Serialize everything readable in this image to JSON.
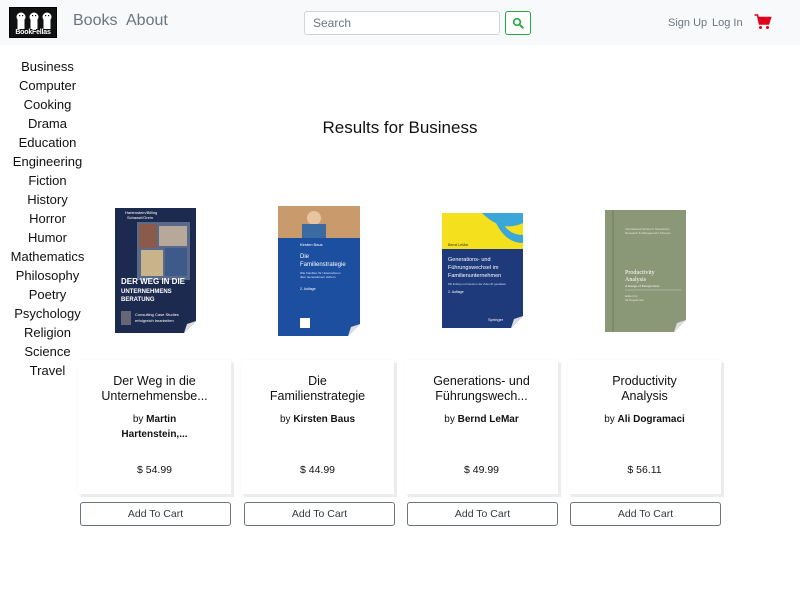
{
  "header": {
    "logo_text": "BookFellas",
    "nav_books": "Books",
    "nav_about": "About",
    "search_placeholder": "Search",
    "sign_up": "Sign Up",
    "log_in": "Log In",
    "cart_color": "#e3001b",
    "search_button_color": "#28a745"
  },
  "sidebar": {
    "categories": [
      "Business",
      "Computer",
      "Cooking",
      "Drama",
      "Education",
      "Engineering",
      "Fiction",
      "History",
      "Horror",
      "Humor",
      "Mathematics",
      "Philosophy",
      "Poetry",
      "Psychology",
      "Religion",
      "Science",
      "Travel"
    ]
  },
  "main": {
    "results_title": "Results for Business",
    "add_to_cart_label": "Add To Cart",
    "books": [
      {
        "title_line1": "Der Weg in die",
        "title_line2": "Unternehmensbe...",
        "by": "by",
        "author_line1": "Martin",
        "author_line2": "Hartenstein,...",
        "price": "$ 54.99",
        "cover_text_top": "Hartenstein/Billing Schawel/Grein",
        "cover_title": "DER WEG IN DIE UNTERNEHMENS BERATUNG",
        "cover_sub": "Consulting Case Studies erfolgreich bearbeiten",
        "cover_color": "#1d2a4f"
      },
      {
        "title_line1": "Die",
        "title_line2": "Familienstrategie",
        "by": "by",
        "author_line1": "Kirsten Baus",
        "author_line2": "",
        "price": "$ 44.99",
        "cover_text_top": "Kirsten Baus",
        "cover_title": "Die Familienstrategie",
        "cover_sub": "Wie Familien ihr Unternehmen über Generationen sichern",
        "cover_edition": "2. Auflage",
        "cover_color": "#1c4fa0"
      },
      {
        "title_line1": "Generations- und",
        "title_line2": "Führungswech...",
        "by": "by",
        "author_line1": "Bernd LeMar",
        "author_line2": "",
        "price": "$ 49.99",
        "cover_text_top": "Bernd LeMar",
        "cover_title": "Generations- und Führungswechsel im Familienunternehmen",
        "cover_sub": "Mit Erfolg und Gewinn die Zukunft gestalten",
        "cover_edition": "2. Auflage",
        "cover_color": "#1e3a7a"
      },
      {
        "title_line1": "Productivity",
        "title_line2": "Analysis",
        "by": "by",
        "author_line1": "Ali Dogramaci",
        "author_line2": "",
        "price": "$ 56.11",
        "cover_title": "Productivity Analysis",
        "cover_sub": "A Range of Perspectives",
        "cover_color": "#8a9878"
      }
    ]
  }
}
